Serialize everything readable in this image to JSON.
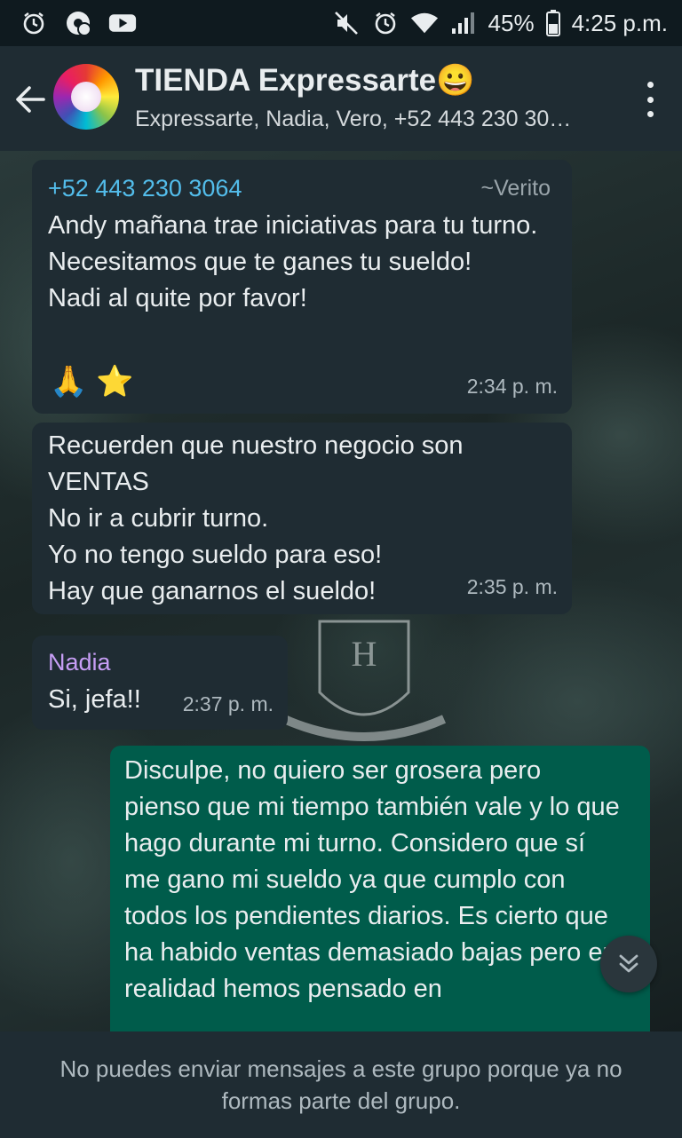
{
  "status_bar": {
    "battery": "45%",
    "time": "4:25 p.m.",
    "left_icons": [
      "alarm-icon",
      "chrome-notification-icon",
      "youtube-icon"
    ],
    "right_icons": [
      "mute-icon",
      "alarm-icon",
      "wifi-icon",
      "signal-icon",
      "battery-icon"
    ]
  },
  "header": {
    "title": "TIENDA Expressarte😀",
    "subtitle": "Expressarte, Nadia, Vero, +52 443 230 30…"
  },
  "messages": [
    {
      "sender": "+52 443 230 3064",
      "sender_color": "#53bdeb",
      "pushname": "~Verito",
      "text": "Andy mañana trae iniciativas para tu turno.\nNecesitamos que te ganes tu sueldo!\nNadi al quite por favor!",
      "emojis": [
        "🙏",
        "⭐"
      ],
      "time": "2:34 p. m."
    },
    {
      "text": "Recuerden que nuestro negocio son VENTAS\nNo ir a cubrir turno.\nYo no tengo sueldo para eso!\nHay que ganarnos el sueldo!",
      "time": "2:35 p. m."
    },
    {
      "sender": "Nadia",
      "sender_color": "#c79ef5",
      "text": "Si, jefa!!",
      "time": "2:37 p. m."
    },
    {
      "text": "Disculpe, no quiero ser grosera pero pienso que mi tiempo también vale y lo que hago durante mi turno. Considero que sí me gano mi sueldo ya que cumplo con todos los pendientes diarios. Es cierto que ha habido ventas demasiado bajas pero en realidad hemos pensado en"
    }
  ],
  "footer": {
    "notice": "No puedes enviar mensajes a este grupo porque ya no formas parte del grupo."
  },
  "colors": {
    "header_bg": "#1f2c33",
    "incoming_bubble": "#1f2c33",
    "outgoing_bubble": "#005c4b"
  }
}
